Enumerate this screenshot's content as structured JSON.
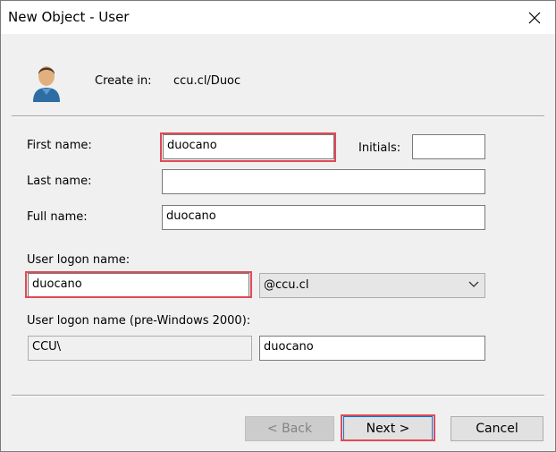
{
  "window": {
    "title": "New Object - User"
  },
  "header": {
    "create_in_label": "Create in:",
    "create_in_value": "ccu.cl/Duoc"
  },
  "form": {
    "first_name": {
      "label": "First name:",
      "value": "duocano"
    },
    "initials": {
      "label": "Initials:",
      "value": ""
    },
    "last_name": {
      "label": "Last name:",
      "value": ""
    },
    "full_name": {
      "label": "Full name:",
      "value": "duocano"
    },
    "logon_name": {
      "label": "User logon name:",
      "value": "duocano"
    },
    "domain_select": {
      "selected": "@ccu.cl"
    },
    "pre2000": {
      "label": "User logon name (pre-Windows 2000):",
      "domain": "CCU\\",
      "value": "duocano"
    }
  },
  "buttons": {
    "back": "< Back",
    "next": "Next >",
    "cancel": "Cancel"
  },
  "colors": {
    "highlight": "#e04a56",
    "window_bg": "#f0f0f0",
    "titlebar_bg": "#ffffff"
  },
  "icons": {
    "close": "close-icon",
    "user": "user-icon",
    "dropdown": "chevron-down-icon"
  }
}
